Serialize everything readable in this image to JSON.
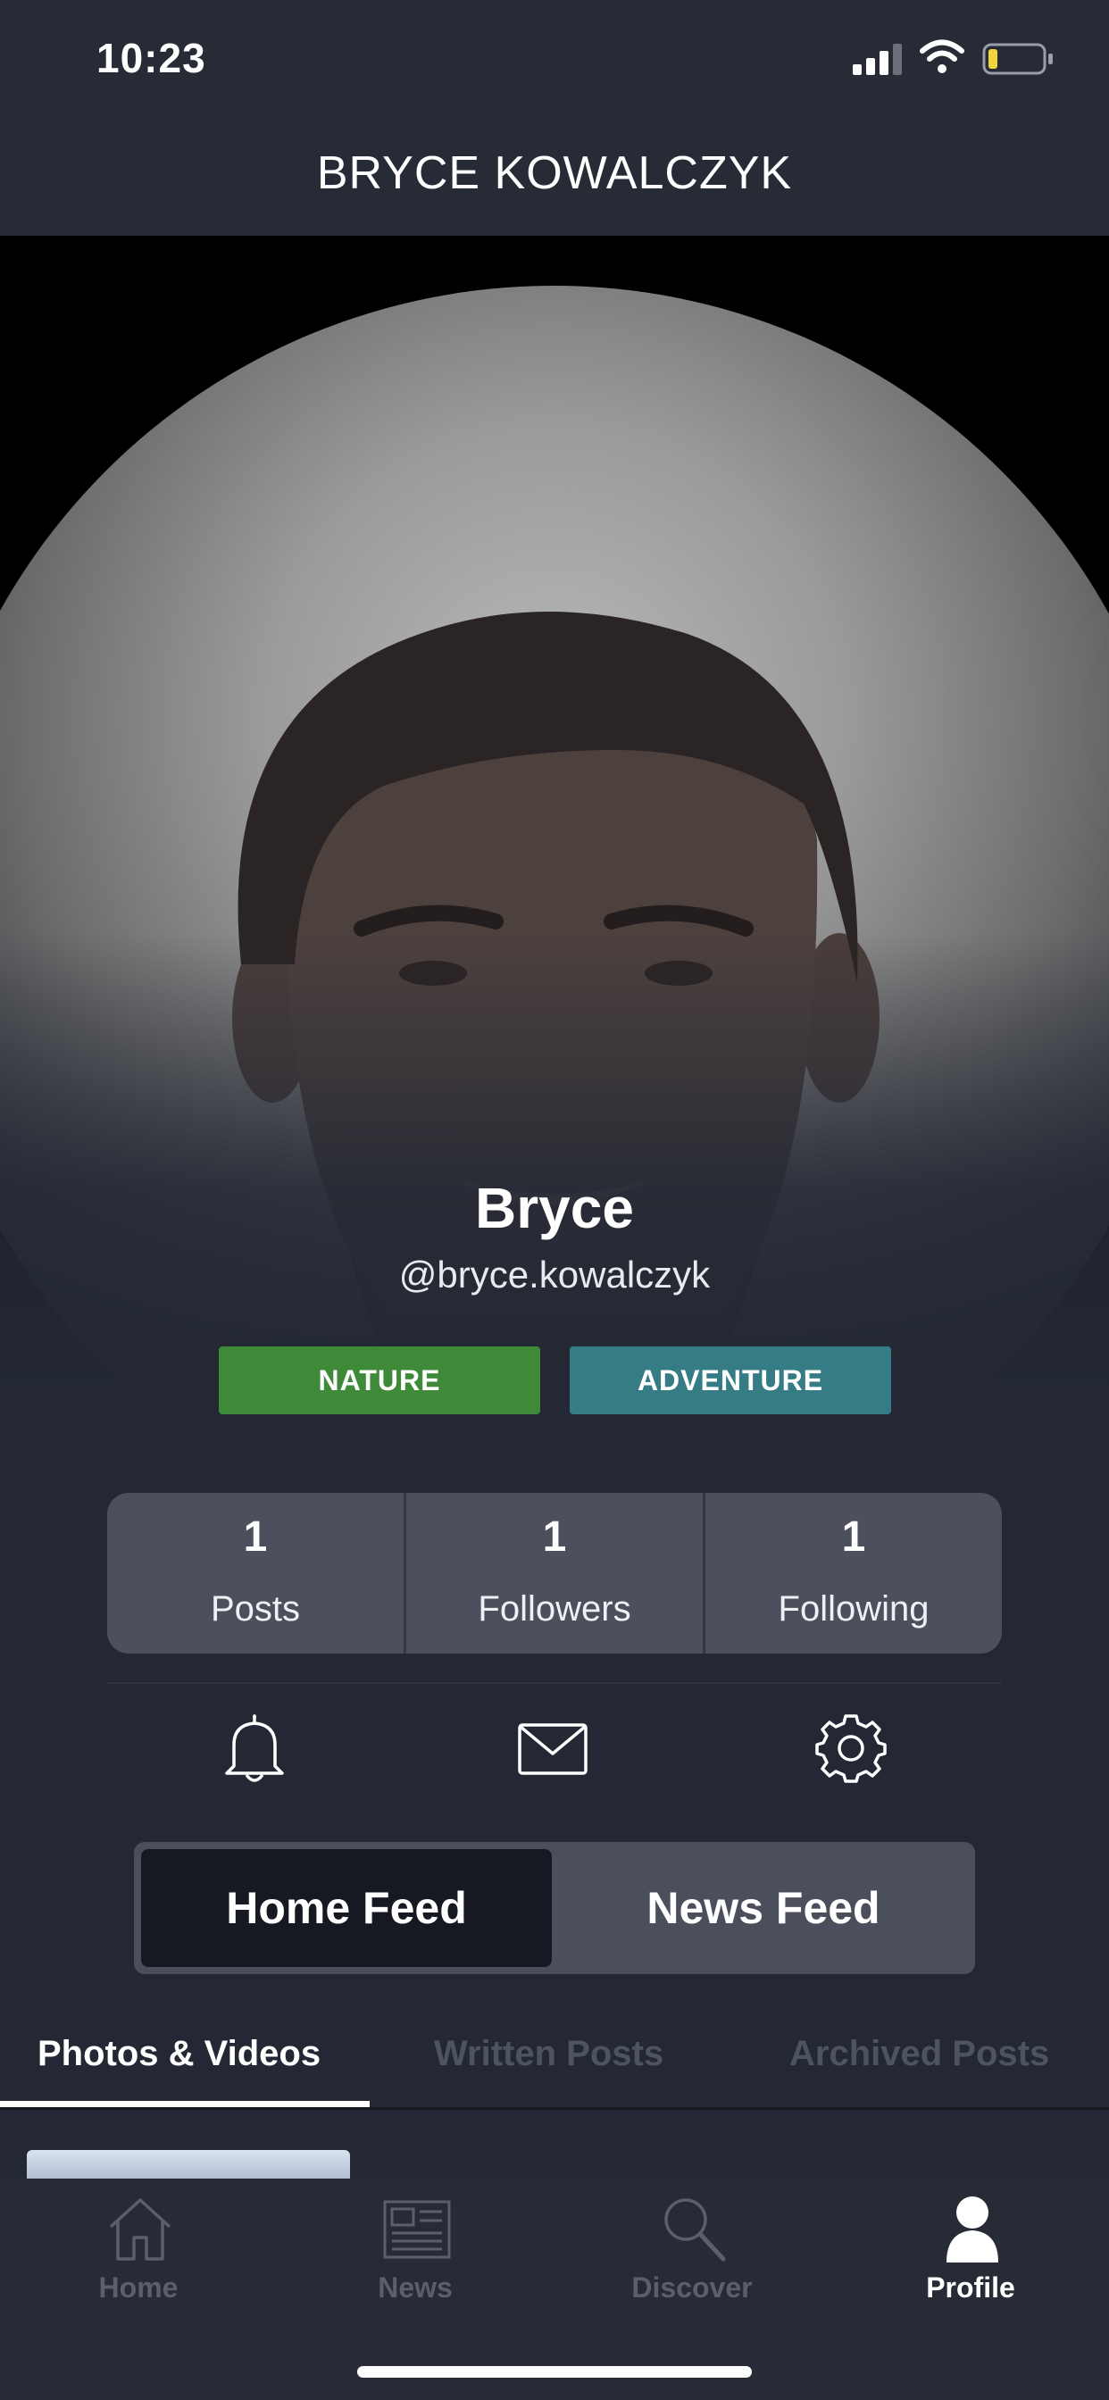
{
  "status_bar": {
    "time": "10:23"
  },
  "header": {
    "title": "BRYCE KOWALCZYK"
  },
  "profile": {
    "name": "Bryce",
    "handle": "@bryce.kowalczyk",
    "tags": [
      "NATURE",
      "ADVENTURE"
    ],
    "tag_colors": [
      "#3e8a38",
      "#357c85"
    ]
  },
  "stats": [
    {
      "value": "1",
      "label": "Posts"
    },
    {
      "value": "1",
      "label": "Followers"
    },
    {
      "value": "1",
      "label": "Following"
    }
  ],
  "actions": {
    "icons": [
      "bell-icon",
      "mail-icon",
      "gear-icon"
    ]
  },
  "feed_toggle": {
    "home": "Home Feed",
    "news": "News Feed",
    "selected": "Home Feed"
  },
  "content_tabs": {
    "photos": "Photos & Videos",
    "written": "Written Posts",
    "archived": "Archived Posts",
    "selected": "Photos & Videos"
  },
  "tab_bar": {
    "items": [
      {
        "label": "Home",
        "icon": "home-icon"
      },
      {
        "label": "News",
        "icon": "news-icon"
      },
      {
        "label": "Discover",
        "icon": "search-icon"
      },
      {
        "label": "Profile",
        "icon": "profile-icon"
      }
    ],
    "active": "Profile"
  }
}
